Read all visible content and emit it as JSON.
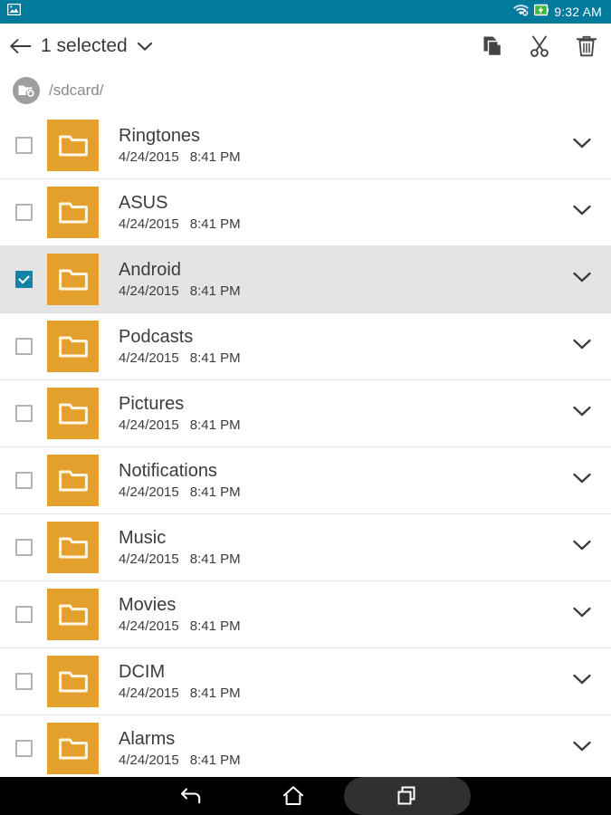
{
  "status_bar": {
    "background": "#017a9b",
    "left_icons": [
      {
        "name": "gallery-image-icon",
        "glyph": "image"
      }
    ],
    "right_icons": [
      {
        "name": "wifi-disconnected-icon",
        "glyph": "wifi-off"
      },
      {
        "name": "battery-charging-icon",
        "glyph": "battery-charging"
      }
    ],
    "clock": "9:32 AM"
  },
  "toolbar": {
    "back_label": "back-arrow",
    "title": "1 selected",
    "dropdown_label": "chevron-down",
    "actions": [
      {
        "name": "copy-button",
        "label": "Copy"
      },
      {
        "name": "cut-button",
        "label": "Cut"
      },
      {
        "name": "delete-button",
        "label": "Delete"
      }
    ]
  },
  "breadcrumb": {
    "up_icon": "folder-up-icon",
    "path": "/sdcard/"
  },
  "list": {
    "accent_folder_color": "#e3a02c",
    "selected_color": "#1484a6",
    "selected_row_bg": "#e4e4e4",
    "items": [
      {
        "name": "Ringtones",
        "date": "4/24/2015",
        "time": "8:41 PM",
        "selected": false
      },
      {
        "name": "ASUS",
        "date": "4/24/2015",
        "time": "8:41 PM",
        "selected": false
      },
      {
        "name": "Android",
        "date": "4/24/2015",
        "time": "8:41 PM",
        "selected": true
      },
      {
        "name": "Podcasts",
        "date": "4/24/2015",
        "time": "8:41 PM",
        "selected": false
      },
      {
        "name": "Pictures",
        "date": "4/24/2015",
        "time": "8:41 PM",
        "selected": false
      },
      {
        "name": "Notifications",
        "date": "4/24/2015",
        "time": "8:41 PM",
        "selected": false
      },
      {
        "name": "Music",
        "date": "4/24/2015",
        "time": "8:41 PM",
        "selected": false
      },
      {
        "name": "Movies",
        "date": "4/24/2015",
        "time": "8:41 PM",
        "selected": false
      },
      {
        "name": "DCIM",
        "date": "4/24/2015",
        "time": "8:41 PM",
        "selected": false
      },
      {
        "name": "Alarms",
        "date": "4/24/2015",
        "time": "8:41 PM",
        "selected": false
      }
    ]
  },
  "nav_bar": {
    "background": "#000000",
    "buttons": [
      {
        "name": "nav-back-button",
        "label": "Back"
      },
      {
        "name": "nav-home-button",
        "label": "Home"
      },
      {
        "name": "nav-recents-button",
        "label": "Recents",
        "highlighted": true
      }
    ]
  }
}
